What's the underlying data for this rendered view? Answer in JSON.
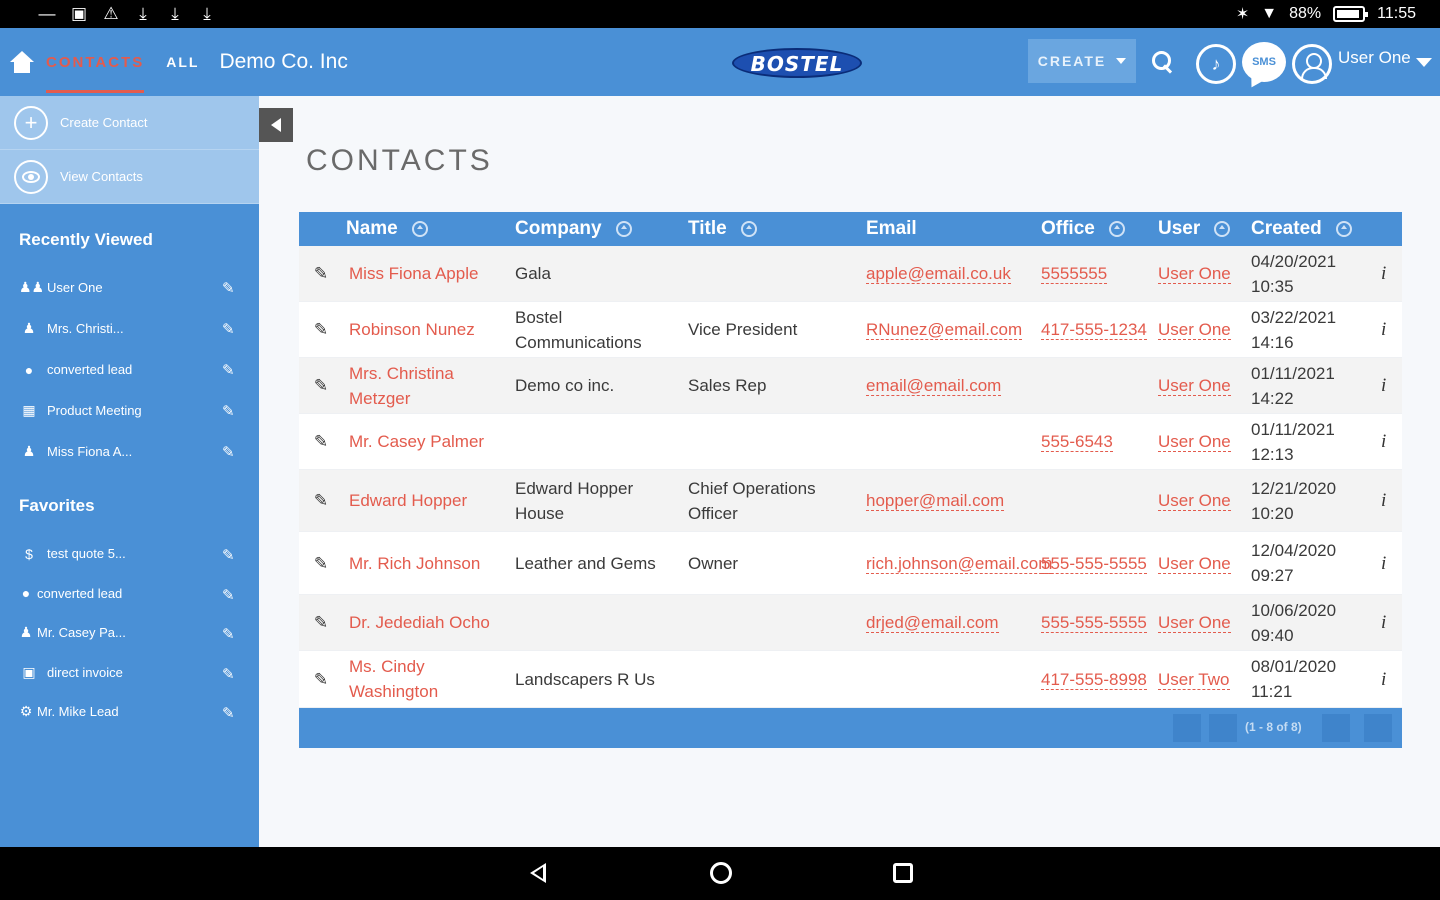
{
  "status_bar": {
    "left_icons": [
      "dash",
      "image-icon",
      "warning-icon",
      "download-icon",
      "download-icon",
      "download-icon"
    ],
    "battery": "88%",
    "time": "11:55"
  },
  "header": {
    "nav_contacts": "CONTACTS",
    "nav_all": "ALL",
    "company": "Demo Co. Inc",
    "logo_text": "BOSTEL",
    "create_label": "CREATE",
    "sms_label": "SMS",
    "user_name": "User One",
    "colors": {
      "bar": "#4a90d6",
      "accent": "#e35b4d"
    }
  },
  "sidebar": {
    "actions": [
      {
        "label": "Create Contact",
        "icon": "plus-circle-icon"
      },
      {
        "label": "View Contacts",
        "icon": "eye-circle-icon"
      }
    ],
    "recently_viewed_title": "Recently Viewed",
    "recently_viewed": [
      {
        "label": "User One",
        "icon": "users-icon"
      },
      {
        "label": "Mrs. Christi...",
        "icon": "person-icon"
      },
      {
        "label": "converted lead",
        "icon": "map-pin-icon"
      },
      {
        "label": "Product Meeting",
        "icon": "calendar-icon"
      },
      {
        "label": "Miss Fiona A...",
        "icon": "person-icon"
      }
    ],
    "favorites_title": "Favorites",
    "favorites": [
      {
        "label": "test quote 5...",
        "icon": "dollar-icon"
      },
      {
        "label": "converted lead",
        "icon": "map-pin-icon"
      },
      {
        "label": "Mr. Casey Pa...",
        "icon": "person-icon"
      },
      {
        "label": "direct invoice",
        "icon": "document-icon"
      },
      {
        "label": "Mr. Mike Lead",
        "icon": "gear-icon"
      }
    ]
  },
  "main": {
    "title": "CONTACTS",
    "columns": [
      "Name",
      "Company",
      "Title",
      "Email",
      "Office",
      "User",
      "Created"
    ],
    "rows": [
      {
        "name": "Miss Fiona Apple",
        "company": "Gala",
        "title": "",
        "email": "apple@email.co.uk",
        "office": "5555555",
        "user": "User One",
        "created": "04/20/2021 10:35"
      },
      {
        "name": "Robinson Nunez",
        "company": "Bostel Communications",
        "title": "Vice President",
        "email": "RNunez@email.com",
        "office": "417-555-1234",
        "user": "User One",
        "created": "03/22/2021 14:16"
      },
      {
        "name": "Mrs. Christina Metzger",
        "company": "Demo co inc.",
        "title": "Sales Rep",
        "email": "email@email.com",
        "office": "",
        "user": "User One",
        "created": "01/11/2021 14:22"
      },
      {
        "name": "Mr. Casey Palmer",
        "company": "",
        "title": "",
        "email": "",
        "office": "555-6543",
        "user": "User One",
        "created": "01/11/2021 12:13"
      },
      {
        "name": "Edward Hopper",
        "company": "Edward Hopper House",
        "title": "Chief Operations Officer",
        "email": "hopper@mail.com",
        "office": "",
        "user": "User One",
        "created": "12/21/2020 10:20"
      },
      {
        "name": "Mr. Rich Johnson",
        "company": "Leather and Gems",
        "title": "Owner",
        "email": "rich.johnson@email.com",
        "office": "555-555-5555",
        "user": "User One",
        "created": "12/04/2020 09:27"
      },
      {
        "name": "Dr. Jedediah Ocho",
        "company": "",
        "title": "",
        "email": "drjed@email.com",
        "office": "555-555-5555",
        "user": "User One",
        "created": "10/06/2020 09:40"
      },
      {
        "name": "Ms. Cindy Washington",
        "company": "Landscapers R Us",
        "title": "",
        "email": "",
        "office": "417-555-8998",
        "user": "User Two",
        "created": "08/01/2020 11:21"
      }
    ],
    "pagination": "(1 - 8 of 8)"
  }
}
